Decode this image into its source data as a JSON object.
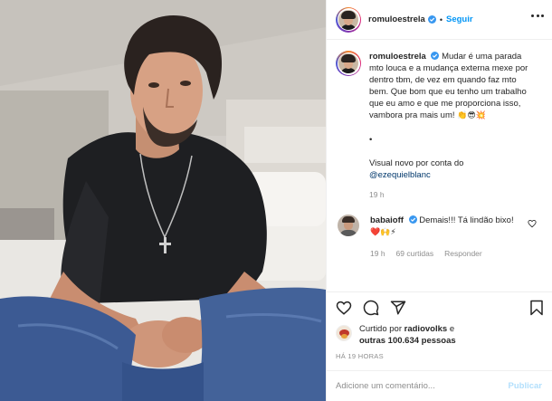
{
  "post": {
    "author": "romuloestrela",
    "verified": true,
    "follow_label": "Seguir",
    "more_icon": "more-options-icon",
    "caption_lines": [
      "Mudar é uma parada mto louca e a mudança externa mexe por dentro tbm, de vez em quando faz mto bem. Que bom que eu tenho um trabalho que eu amo e que me proporciona isso, vambora pra mais um!",
      "•",
      "Visual novo por conta do"
    ],
    "caption_emojis": "👏😎💥",
    "caption_mention": "@ezequielblanc",
    "caption_time": "19 h"
  },
  "comment": {
    "username": "babaioff",
    "verified": true,
    "text": "Demais!!! Tá lindão bixo!",
    "emojis": "❤️🙌⚡",
    "time": "19 h",
    "likes": "69 curtidas",
    "reply_label": "Responder"
  },
  "likes_block": {
    "prefix": "Curtido por",
    "first_user": "radiovolks",
    "middle": "e",
    "others": "outras 100.634 pessoas",
    "age": "HÁ 19 HORAS"
  },
  "composer": {
    "placeholder": "Adicione um comentário...",
    "publish_label": "Publicar"
  },
  "icons": {
    "like": "heart-icon",
    "comment": "comment-icon",
    "share": "share-icon",
    "save": "bookmark-icon"
  },
  "colors": {
    "accent": "#0095f6",
    "text": "#262626",
    "muted": "#8e8e8e",
    "border": "#efefef",
    "publish_disabled": "#b2dffc"
  }
}
